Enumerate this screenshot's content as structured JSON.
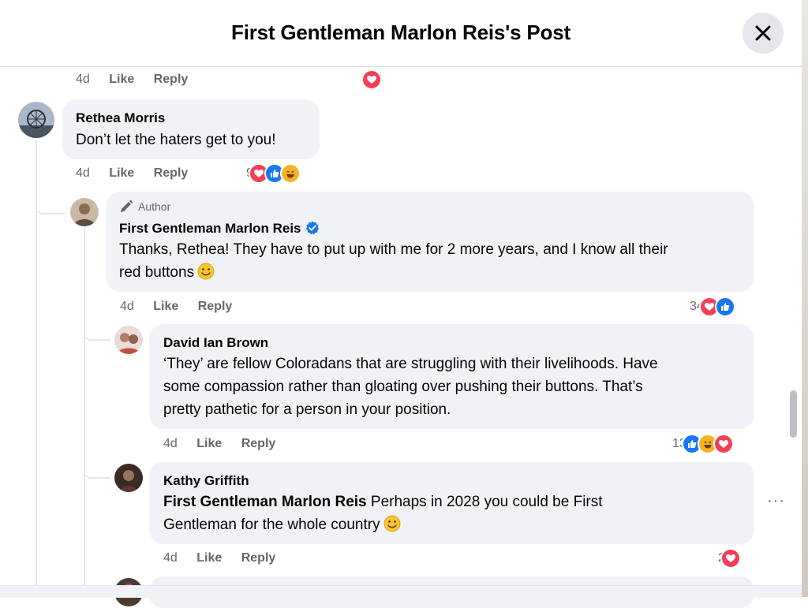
{
  "header": {
    "title": "First Gentleman Marlon Reis's Post"
  },
  "prev_meta": {
    "time": "4d",
    "like": "Like",
    "reply": "Reply"
  },
  "comments": [
    {
      "name": "Rethea Morris",
      "text": "Don’t let the haters get to you!",
      "time": "4d",
      "like": "Like",
      "reply": "Reply",
      "reaction_count": "9",
      "reactions": [
        "love-icon",
        "like-icon",
        "haha-icon"
      ]
    },
    {
      "badge": "Author",
      "name": "First Gentleman Marlon Reis",
      "text_line1": "Thanks, Rethea! They have to put up with me for 2 more years, and I know all their",
      "text_line2": "red buttons",
      "time": "4d",
      "like": "Like",
      "reply": "Reply",
      "reaction_count": "34",
      "reactions": [
        "love-icon",
        "like-icon"
      ]
    },
    {
      "name": "David Ian Brown",
      "text_line1": "‘They’ are fellow Coloradans that are struggling with their livelihoods. Have",
      "text_line2": "some compassion rather than gloating over pushing their buttons. That’s",
      "text_line3": "pretty pathetic for a person in your position.",
      "time": "4d",
      "like": "Like",
      "reply": "Reply",
      "reaction_count": "13",
      "reactions": [
        "like-icon",
        "haha-icon",
        "love-icon"
      ]
    },
    {
      "name": "Kathy Griffith",
      "mention": "First Gentleman Marlon Reis",
      "text_line1": " Perhaps in 2028 you could be First",
      "text_line2": "Gentleman for the whole country",
      "time": "4d",
      "like": "Like",
      "reply": "Reply",
      "reaction_count": "2",
      "reactions": [
        "love-icon"
      ]
    }
  ],
  "more_options": "···",
  "colors": {
    "love": "#f33e58",
    "like": "#1877f2",
    "haha": "#f7b125",
    "bubble": "#f0f2f5",
    "meta": "#65676b"
  }
}
